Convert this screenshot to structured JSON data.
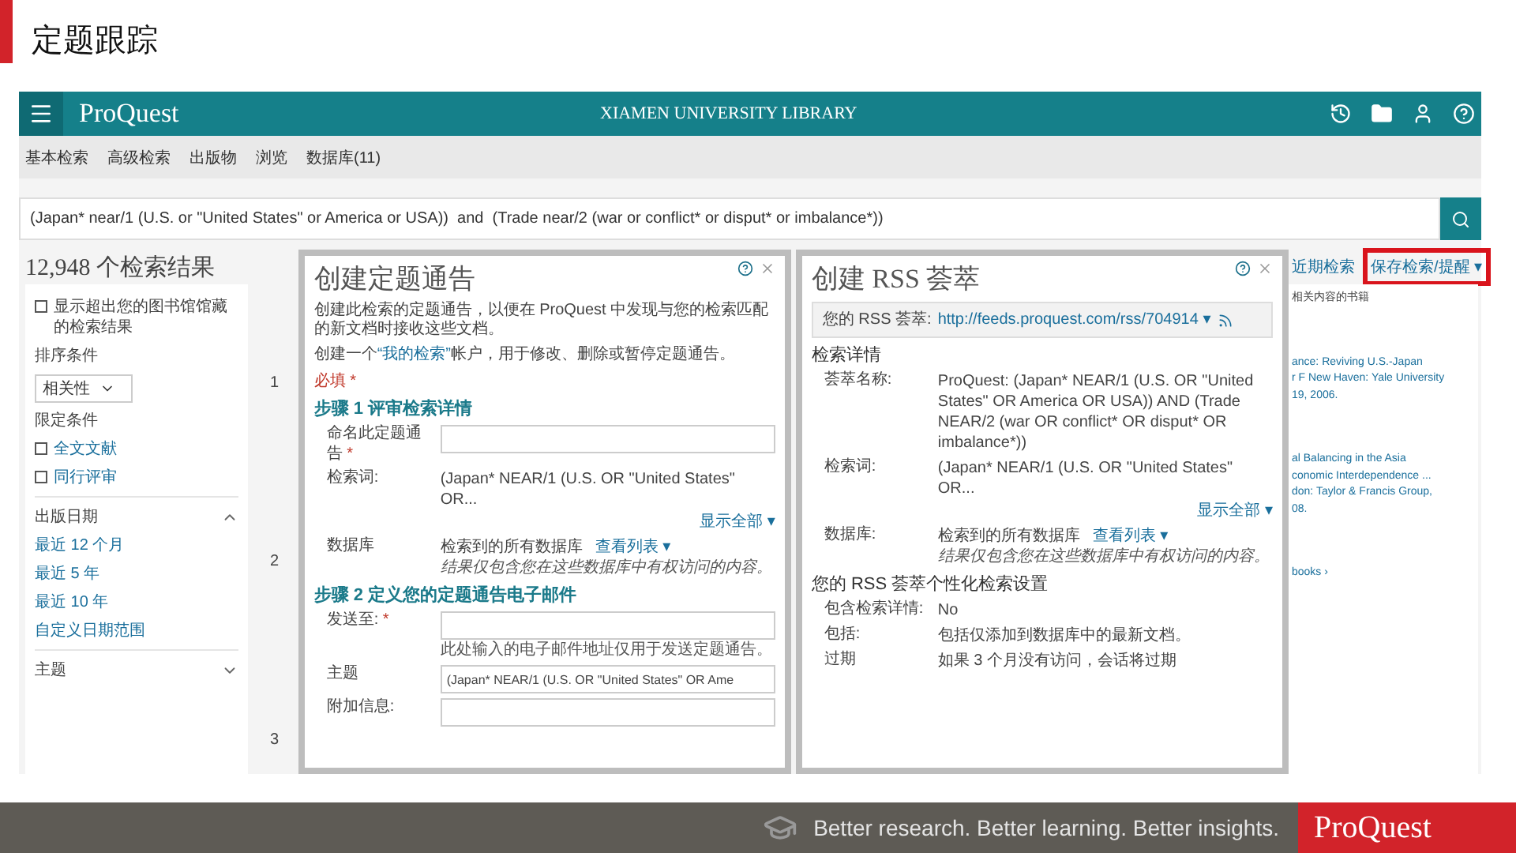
{
  "slide_title": "定题跟踪",
  "header": {
    "logo": "ProQuest",
    "library": "XIAMEN UNIVERSITY LIBRARY"
  },
  "nav": [
    "基本检索",
    "高级检索",
    "出版物",
    "浏览",
    "数据库(11)"
  ],
  "search": {
    "value": "(Japan* near/1 (U.S. or \"United States\" or America or USA))  and  (Trade near/2 (war or conflict* or disput* or imbalance*))"
  },
  "result_count": "12,948 个检索结果",
  "sidebar": {
    "scholarly": {
      "label": "显示超出您的图书馆馆藏的检索结果",
      "checked": false
    },
    "sort_label": "排序条件",
    "sort_value": "相关性",
    "limit_label": "限定条件",
    "limits": [
      {
        "label": "全文文献",
        "checked": false
      },
      {
        "label": "同行评审",
        "checked": false
      }
    ],
    "sections": [
      {
        "title": "出版日期",
        "expanded": true,
        "links": [
          "最近 12 个月",
          "最近 5 年",
          "最近 10 年",
          "自定义日期范围"
        ]
      },
      {
        "title": "主题",
        "expanded": false
      }
    ]
  },
  "result_numbers": [
    "1",
    "2",
    "3"
  ],
  "search_links": [
    {
      "label": "近期检索",
      "marked": false
    },
    {
      "label": "保存检索/提醒 ▾",
      "marked": true
    }
  ],
  "alert_dialog": {
    "title": "创建定题通告",
    "intro": "创建此检索的定题通告，以便在 ProQuest 中发现与您的检索匹配的新文档时接收这些文档。",
    "account": {
      "before": "创建一个",
      "link": "“我的检索”",
      "after": "帐户，用于修改、删除或暂停定题通告。"
    },
    "required_note": "必填 *",
    "sections": [
      {
        "heading": "步骤 1 评审检索详情",
        "rows": [
          {
            "kind": "input",
            "label": "命名此定题通告",
            "required": "*"
          },
          {
            "kind": "link_below",
            "label": "检索词:",
            "value": "(Japan* NEAR/1 (U.S. OR \"United States\" OR...",
            "link": "显示全部 ▾"
          },
          {
            "kind": "link_inline",
            "label": "数据库",
            "value": "检索到的所有数据库",
            "link": "查看列表 ▾",
            "note": "结果仅包含您在这些数据库中有权访问的内容。"
          }
        ]
      },
      {
        "heading": "步骤 2 定义您的定题通告电子邮件",
        "rows": [
          {
            "kind": "input",
            "label": "发送至:",
            "required": "*",
            "hint": "此处输入的电子邮件地址仅用于发送定题通告。"
          },
          {
            "kind": "input",
            "label": "主题",
            "value": "(Japan* NEAR/1 (U.S. OR \"United States\" OR Ame"
          },
          {
            "kind": "input",
            "label": "附加信息:"
          }
        ]
      }
    ]
  },
  "rss_dialog": {
    "title": "创建 RSS 荟萃",
    "feed": {
      "label": "您的 RSS 荟萃:",
      "url": "http://feeds.proquest.com/rss/704914 ▾"
    },
    "sections": [
      {
        "heading": "检索详情",
        "rows": [
          {
            "kind": "info",
            "label": "荟萃名称:",
            "value": "ProQuest: (Japan* NEAR/1 (U.S. OR \"United States\" OR America OR USA)) AND (Trade NEAR/2 (war OR conflict* OR disput* OR imbalance*))"
          },
          {
            "kind": "link_below",
            "label": "检索词:",
            "value": "(Japan* NEAR/1 (U.S. OR \"United States\" OR...",
            "link": "显示全部 ▾"
          },
          {
            "kind": "link_inline",
            "label": "数据库:",
            "value": "检索到的所有数据库",
            "link": "查看列表 ▾",
            "note": "结果仅包含您在这些数据库中有权访问的内容。"
          }
        ]
      },
      {
        "heading": "您的 RSS 荟萃个性化检索设置",
        "rows": [
          {
            "kind": "info",
            "label": "包含检索详情:",
            "value": "No"
          },
          {
            "kind": "info",
            "label": "包括:",
            "value": "包括仅添加到数据库中的最新文档。"
          },
          {
            "kind": "info",
            "label": "过期",
            "value": "如果 3 个月没有访问，会话将过期"
          }
        ]
      }
    ]
  },
  "related": {
    "title": "相关内容的书籍",
    "items": [
      {
        "lines": [
          "ance: Reviving U.S.-Japan",
          "r F New Haven: Yale University",
          "19, 2006."
        ]
      },
      {
        "lines": [
          "al Balancing in the Asia",
          "conomic Interdependence ...",
          "don: Taylor & Francis Group,",
          "08."
        ]
      }
    ],
    "more": "books ›"
  },
  "footer": {
    "tagline": "Better research. Better learning. Better insights.",
    "brand": "ProQuest"
  }
}
